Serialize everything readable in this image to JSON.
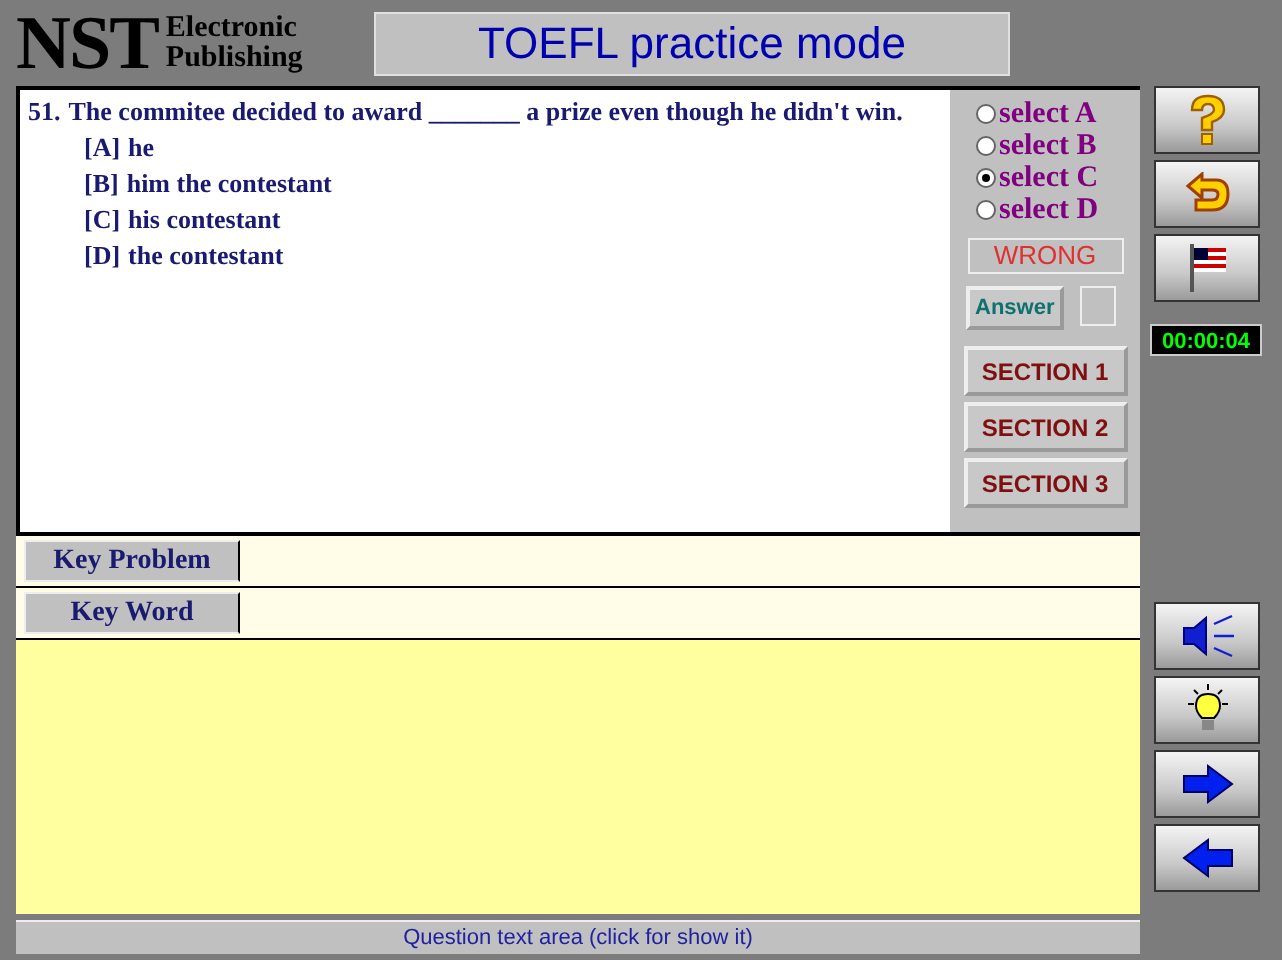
{
  "logo": {
    "mark": "NST",
    "line_1": "Electronic",
    "line_2": "Publishing"
  },
  "title": "TOEFL practice mode",
  "question": {
    "number": "51.",
    "text": "The commitee decided to award _______ a prize even though he didn't win.",
    "options": [
      {
        "letter": "[A]",
        "text": "he"
      },
      {
        "letter": "[B]",
        "text": "him the contestant"
      },
      {
        "letter": "[C]",
        "text": "his contestant"
      },
      {
        "letter": "[D]",
        "text": "the contestant"
      }
    ]
  },
  "choices": [
    {
      "label": "select A",
      "selected": false
    },
    {
      "label": "select B",
      "selected": false
    },
    {
      "label": "select C",
      "selected": true
    },
    {
      "label": "select D",
      "selected": false
    }
  ],
  "result": "WRONG",
  "answer_button": "Answer",
  "sections": [
    "SECTION 1",
    "SECTION 2",
    "SECTION 3"
  ],
  "key_rows": [
    {
      "label": "Key Problem"
    },
    {
      "label": "Key Word"
    }
  ],
  "timer": "00:00:04",
  "status_bar": "Question text area (click for show it)"
}
